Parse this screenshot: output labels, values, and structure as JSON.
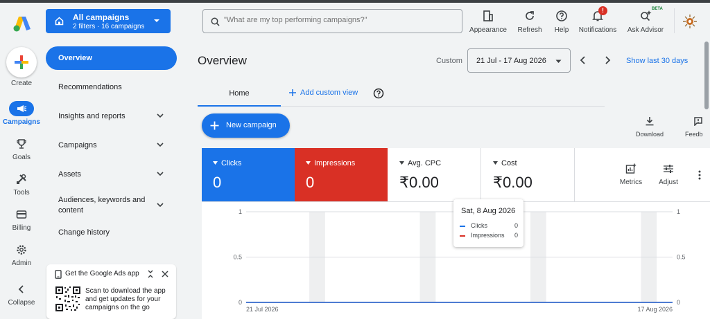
{
  "rail": {
    "create_label": "Create",
    "items": [
      {
        "label": "Campaigns"
      },
      {
        "label": "Goals"
      },
      {
        "label": "Tools"
      },
      {
        "label": "Billing"
      },
      {
        "label": "Admin"
      },
      {
        "label": "Collapse"
      }
    ]
  },
  "account": {
    "title": "All campaigns",
    "subtitle": "2 filters · 16 campaigns"
  },
  "search": {
    "placeholder": "\"What are my top performing campaigns?\""
  },
  "toolbar": {
    "appearance": "Appearance",
    "refresh": "Refresh",
    "help": "Help",
    "notifications": "Notifications",
    "notification_badge": "!",
    "ask_advisor": "Ask Advisor",
    "beta": "BETA"
  },
  "nav": {
    "items": [
      {
        "label": "Overview"
      },
      {
        "label": "Recommendations"
      },
      {
        "label": "Insights and reports"
      },
      {
        "label": "Campaigns"
      },
      {
        "label": "Assets"
      },
      {
        "label": "Audiences, keywords and content"
      },
      {
        "label": "Change history"
      }
    ]
  },
  "app_card": {
    "title": "Get the Google Ads app",
    "text": "Scan to download the app and get updates for your campaigns on the go"
  },
  "main": {
    "title": "Overview",
    "custom_label": "Custom",
    "date_range": "21 Jul - 17 Aug 2026",
    "show_last": "Show last 30 days",
    "tab_home": "Home",
    "add_custom_view": "Add custom view",
    "new_campaign": "New campaign",
    "download": "Download",
    "feedback": "Feedb"
  },
  "metrics": [
    {
      "label": "Clicks",
      "value": "0",
      "color": "#1a73e8"
    },
    {
      "label": "Impressions",
      "value": "0",
      "color": "#d93025"
    },
    {
      "label": "Avg. CPC",
      "value": "₹0.00"
    },
    {
      "label": "Cost",
      "value": "₹0.00"
    }
  ],
  "metric_buttons": {
    "metrics": "Metrics",
    "adjust": "Adjust"
  },
  "chart_data": {
    "type": "line",
    "x_start_label": "21 Jul 2026",
    "x_end_label": "17 Aug 2026",
    "y_ticks": [
      "0",
      "0.5",
      "1"
    ],
    "ylim": [
      0,
      1
    ],
    "series": [
      {
        "name": "Clicks",
        "color": "#1a73e8",
        "values": [
          0,
          0,
          0,
          0,
          0,
          0,
          0,
          0,
          0,
          0,
          0,
          0,
          0,
          0,
          0,
          0,
          0,
          0,
          0,
          0,
          0,
          0,
          0,
          0,
          0,
          0,
          0,
          0
        ]
      },
      {
        "name": "Impressions",
        "color": "#d93025",
        "values": [
          0,
          0,
          0,
          0,
          0,
          0,
          0,
          0,
          0,
          0,
          0,
          0,
          0,
          0,
          0,
          0,
          0,
          0,
          0,
          0,
          0,
          0,
          0,
          0,
          0,
          0,
          0,
          0
        ]
      }
    ]
  },
  "tooltip": {
    "date": "Sat, 8 Aug 2026",
    "rows": [
      {
        "name": "Clicks",
        "value": "0"
      },
      {
        "name": "Impressions",
        "value": "0"
      }
    ]
  }
}
